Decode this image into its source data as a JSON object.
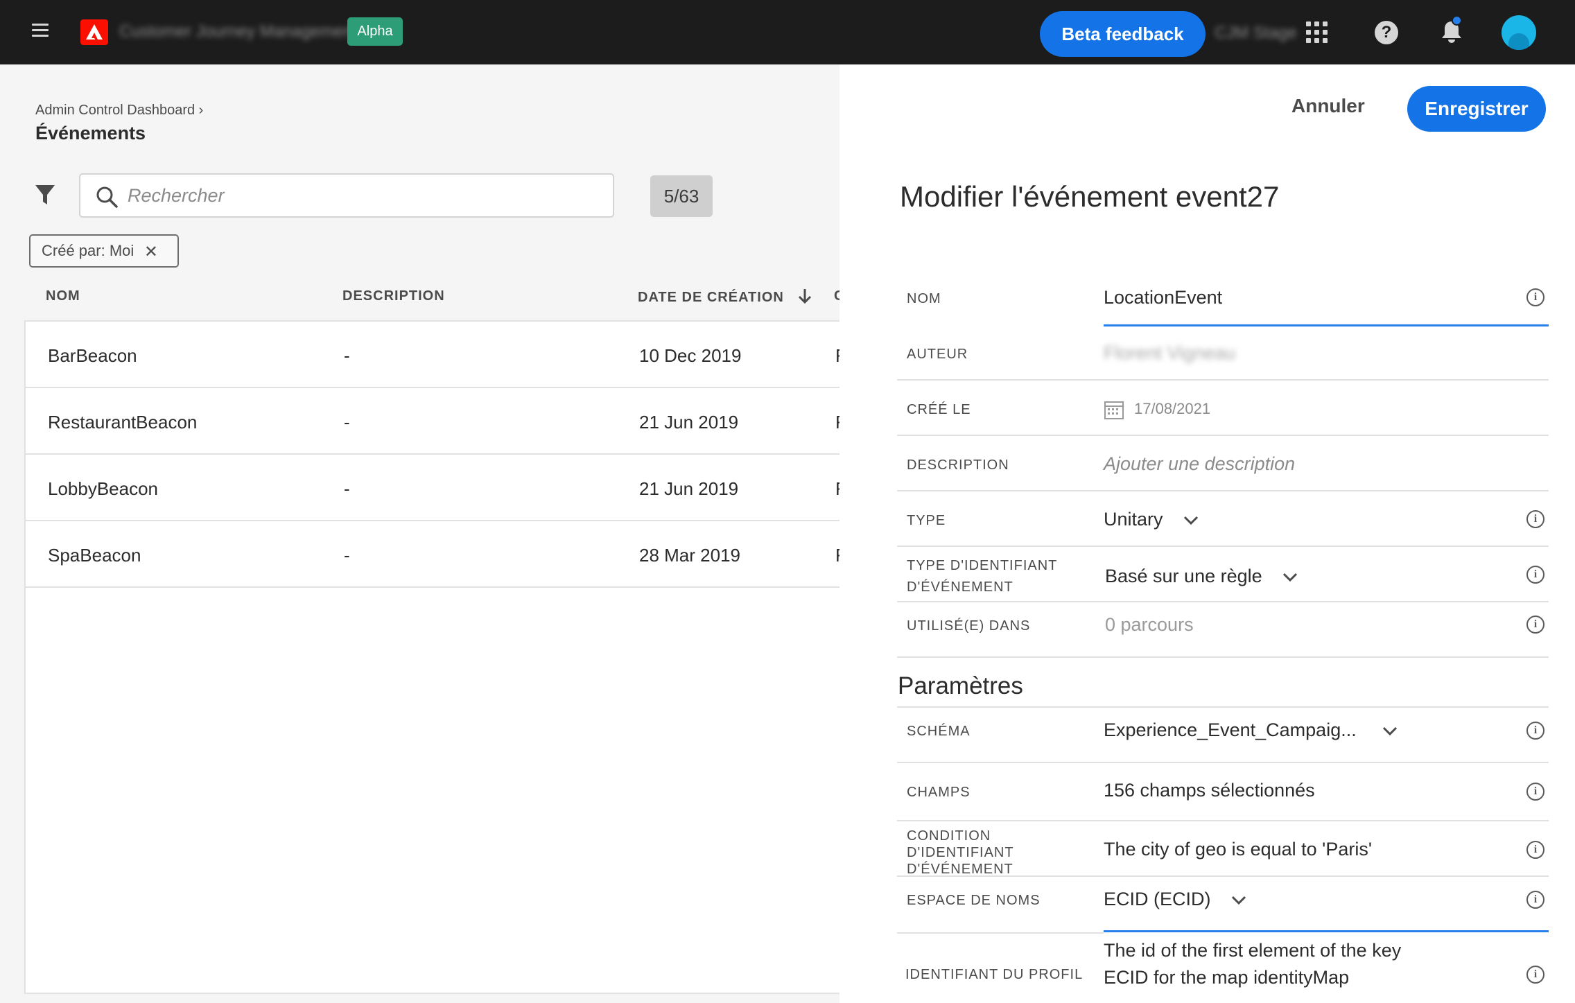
{
  "topbar": {
    "app_name": "Customer Journey Management",
    "badge": "Alpha",
    "beta_feedback": "Beta feedback",
    "org_name": "CJM Stage"
  },
  "left": {
    "breadcrumb": "Admin Control Dashboard ›",
    "title": "Événements",
    "search_placeholder": "Rechercher",
    "count": "5/63",
    "chip_label": "Créé par: Moi",
    "columns": {
      "name": "NOM",
      "description": "DESCRIPTION",
      "created": "DATE DE CRÉATION",
      "extra": "C"
    },
    "rows": [
      {
        "name": "BarBeacon",
        "description": "-",
        "created": "10 Dec 2019",
        "extra": "F"
      },
      {
        "name": "RestaurantBeacon",
        "description": "-",
        "created": "21 Jun 2019",
        "extra": "F"
      },
      {
        "name": "LobbyBeacon",
        "description": "-",
        "created": "21 Jun 2019",
        "extra": "F"
      },
      {
        "name": "SpaBeacon",
        "description": "-",
        "created": "28 Mar 2019",
        "extra": "F"
      }
    ]
  },
  "right": {
    "cancel": "Annuler",
    "save": "Enregistrer",
    "title": "Modifier l'événement event27",
    "fields": {
      "name": {
        "label": "NOM",
        "value": "LocationEvent"
      },
      "author": {
        "label": "AUTEUR",
        "value": "Florent Vigneau"
      },
      "created": {
        "label": "CRÉÉ LE",
        "value": "17/08/2021"
      },
      "description": {
        "label": "DESCRIPTION",
        "value": "Ajouter une description"
      },
      "type": {
        "label": "TYPE",
        "value": "Unitary"
      },
      "id_type": {
        "label_1": "TYPE D'IDENTIFIANT",
        "label_2": "D'ÉVÉNEMENT",
        "value": "Basé sur une règle"
      },
      "used_in": {
        "label": "UTILISÉ(E) DANS",
        "value": "0 parcours"
      }
    },
    "section_title": "Paramètres",
    "params": {
      "schema": {
        "label": "SCHÉMA",
        "value": "Experience_Event_Campaig..."
      },
      "fields": {
        "label": "CHAMPS",
        "value": "156 champs sélectionnés"
      },
      "condition": {
        "label_1": "CONDITION",
        "label_2": "D'IDENTIFIANT",
        "label_3": "D'ÉVÉNEMENT",
        "value": "The city of geo is equal to 'Paris'"
      },
      "namespace": {
        "label": "ESPACE DE NOMS",
        "value": "ECID (ECID)"
      },
      "profile_id": {
        "label": "IDENTIFIANT DU PROFIL",
        "value_1": "The id of the first element of the key",
        "value_2": "ECID for the map identityMap"
      }
    }
  }
}
